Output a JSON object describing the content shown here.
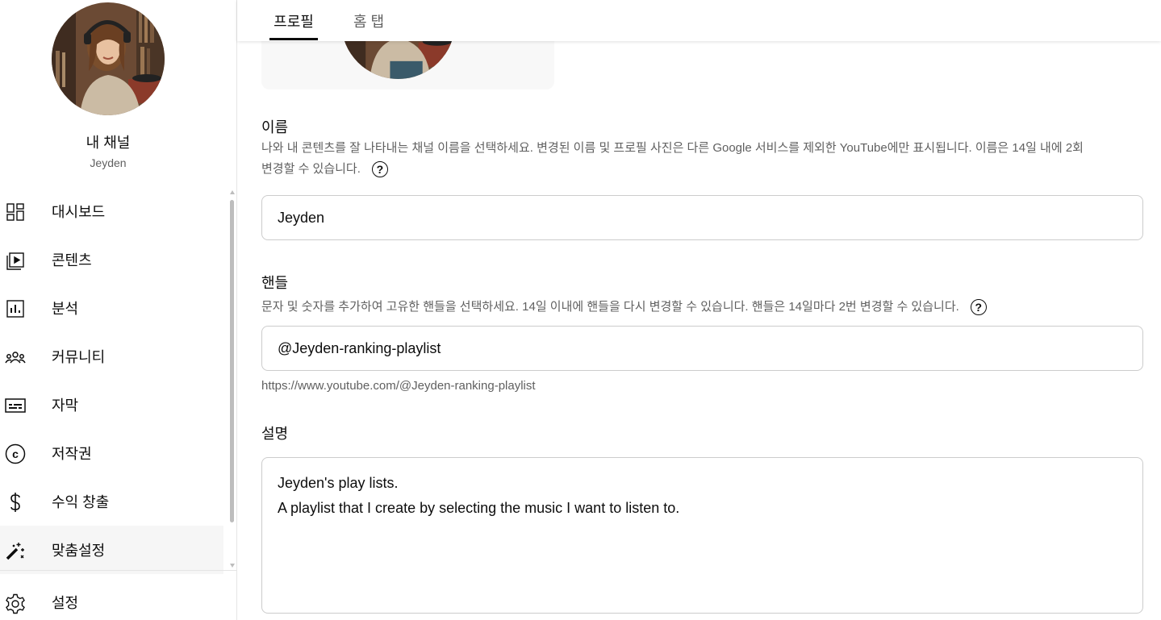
{
  "sidebar": {
    "channel_title": "내 채널",
    "channel_name": "Jeyden",
    "items": [
      {
        "label": "대시보드",
        "icon": "dashboard-icon"
      },
      {
        "label": "콘텐츠",
        "icon": "content-icon"
      },
      {
        "label": "분석",
        "icon": "analytics-icon"
      },
      {
        "label": "커뮤니티",
        "icon": "community-icon"
      },
      {
        "label": "자막",
        "icon": "subtitles-icon"
      },
      {
        "label": "저작권",
        "icon": "copyright-icon"
      },
      {
        "label": "수익 창출",
        "icon": "monetization-icon"
      },
      {
        "label": "맞춤설정",
        "icon": "customization-icon",
        "active": true
      }
    ],
    "settings_label": "설정"
  },
  "tabs": {
    "profile": "프로필",
    "home": "홈 탭"
  },
  "name_section": {
    "title": "이름",
    "desc_line1": "나와 내 콘텐츠를 잘 나타내는 채널 이름을 선택하세요. 변경된 이름 및 프로필 사진은 다른 Google 서비스를 제외한 YouTube에만 표시됩니다. 이름은 14일 내에 2회",
    "desc_line2": "변경할 수 있습니다.",
    "value": "Jeyden"
  },
  "handle_section": {
    "title": "핸들",
    "desc": "문자 및 숫자를 추가하여 고유한 핸들을 선택하세요. 14일 이내에 핸들을 다시 변경할 수 있습니다. 핸들은 14일마다 2번 변경할 수 있습니다.",
    "value": "@Jeyden-ranking-playlist",
    "url": "https://www.youtube.com/@Jeyden-ranking-playlist"
  },
  "description_section": {
    "title": "설명",
    "value": "Jeyden's play lists.\nA playlist that I create by selecting the music I want to listen to."
  },
  "help_glyph": "?",
  "colors": {
    "text_primary": "#0d0d0d",
    "text_secondary": "#606060",
    "border": "#cccccc",
    "active_bg": "#f6f6f6"
  }
}
